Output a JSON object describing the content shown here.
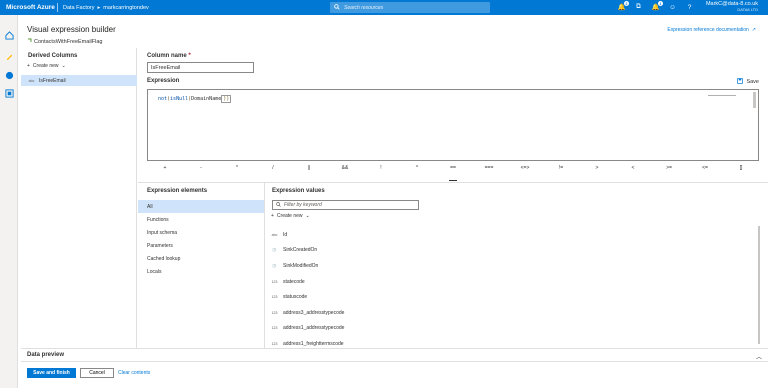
{
  "topbar": {
    "brand": "Microsoft Azure",
    "service": "Data Factory",
    "factory": "markcarringtondev",
    "search_placeholder": "Search resources",
    "badges": {
      "notifications": "2",
      "alerts": "1"
    },
    "user_email": "MarkC@data-8.co.uk",
    "user_tenant": "DATA8 LTD"
  },
  "header": {
    "title": "Visual expression builder",
    "subtitle": "ContactsWithFreeEmailFlag",
    "ref_doc": "Expression reference documentation"
  },
  "derived": {
    "heading": "Derived Columns",
    "create_new": "Create new",
    "items": [
      {
        "label": "IsFreeEmail",
        "type": "abc"
      }
    ]
  },
  "column": {
    "label": "Column name",
    "required": "*",
    "value": "IsFreeEmail"
  },
  "expression": {
    "label": "Expression",
    "save": "Save",
    "code_fn1": "not",
    "code_paren1": "(",
    "code_fn2": "isNull",
    "code_paren2": "(",
    "code_arg": "DomainName",
    "code_close": "))"
  },
  "operators": [
    "+",
    "-",
    "*",
    "/",
    "||",
    "&&",
    "!",
    "^",
    "==",
    "===",
    "<=>",
    "!=",
    ">",
    "<",
    ">=",
    "<=",
    "[]"
  ],
  "selected_operator": "==",
  "elements": {
    "heading": "Expression elements",
    "items": [
      "All",
      "Functions",
      "Input schema",
      "Parameters",
      "Cached lookup",
      "Locals"
    ],
    "selected": "All"
  },
  "values": {
    "heading": "Expression values",
    "filter_placeholder": "Filter by keyword",
    "create_new": "Create new",
    "items": [
      {
        "label": "Id",
        "type": "abc"
      },
      {
        "label": "SinkCreatedOn",
        "type": "clock"
      },
      {
        "label": "SinkModifiedOn",
        "type": "clock"
      },
      {
        "label": "statecode",
        "type": "123"
      },
      {
        "label": "statuscode",
        "type": "123"
      },
      {
        "label": "address3_addresstypecode",
        "type": "123"
      },
      {
        "label": "address1_addresstypecode",
        "type": "123"
      },
      {
        "label": "address1_freighttermscode",
        "type": "123"
      }
    ]
  },
  "preview": {
    "label": "Data preview"
  },
  "footer": {
    "save_finish": "Save and finish",
    "cancel": "Cancel",
    "clear": "Clear contents"
  }
}
